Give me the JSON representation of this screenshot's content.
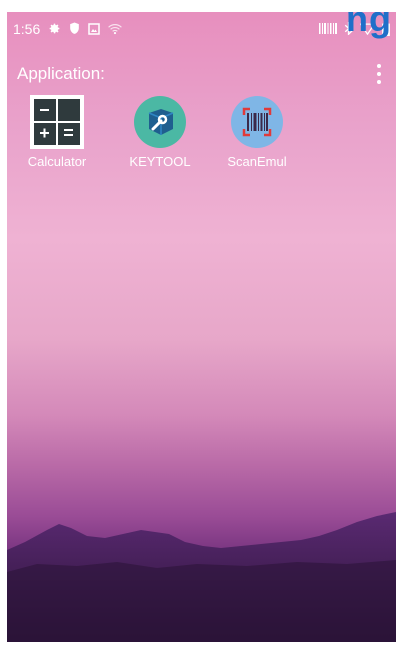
{
  "header_overlay": {
    "text": "ng"
  },
  "status_bar": {
    "time": "1:56",
    "left_icons": [
      "gear-icon",
      "shield-icon",
      "photo-icon",
      "wifi-icon"
    ],
    "right_icons": [
      "barcode-icon",
      "bluetooth-icon",
      "signal-icon",
      "battery-icon"
    ]
  },
  "launcher": {
    "section_label": "Application:",
    "menu_icon": "more-vert-icon",
    "apps": [
      {
        "label": "Calculator",
        "icon": "calculator-icon"
      },
      {
        "label": "KEYTOOL",
        "icon": "keytool-icon"
      },
      {
        "label": "ScanEmul",
        "icon": "barcode-scan-icon"
      }
    ]
  },
  "colors": {
    "frame_top": "#e78fbe",
    "frame_bottom": "#3a1847",
    "overlay_text": "#1f6fc9",
    "calculator_bg": "#2f3a3d",
    "keytool_bg": "#4bb8a4",
    "scanemul_bg": "#7fb6e6"
  }
}
